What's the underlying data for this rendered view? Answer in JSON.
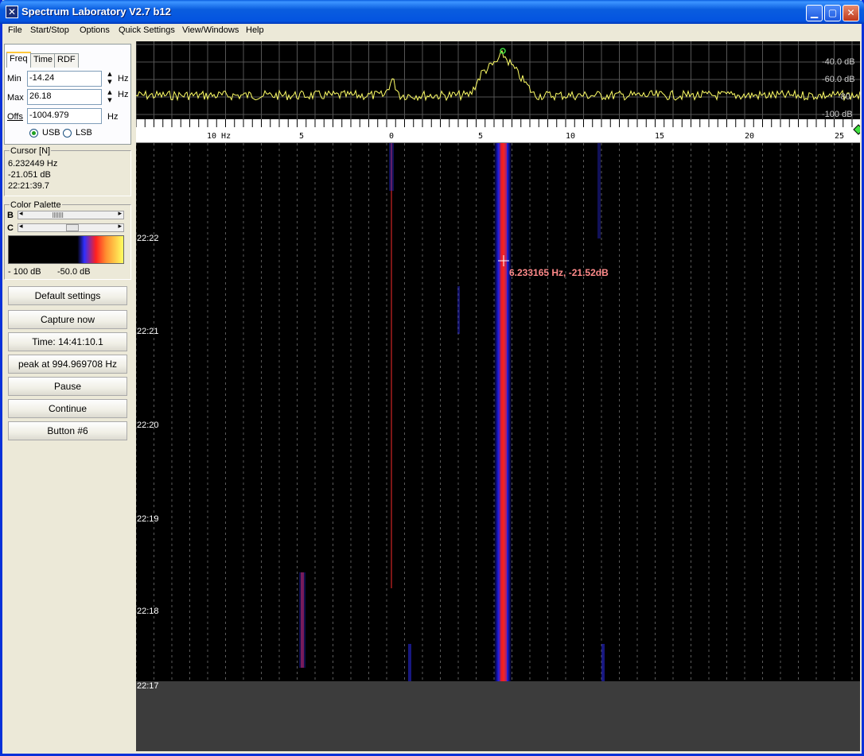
{
  "window": {
    "title": "Spectrum Laboratory V2.7 b12",
    "app_icon": "spectrum-lab-icon"
  },
  "menu": [
    "File",
    "Start/Stop",
    "Options",
    "Quick Settings",
    "View/Windows",
    "Help"
  ],
  "tabs": [
    "Freq",
    "Time",
    "RDF"
  ],
  "freq": {
    "min_label": "Min",
    "min_value": "-14.24",
    "min_unit": "Hz",
    "max_label": "Max",
    "max_value": "26.18",
    "max_unit": "Hz",
    "offs_label": "Offs",
    "offs_value": "-1004.979",
    "offs_unit": "Hz",
    "usb_label": "USB",
    "lsb_label": "LSB"
  },
  "cursor": {
    "title": "Cursor [N]",
    "freq": "6.232449 Hz",
    "level": "-21.051 dB",
    "time": "22:21:39.7"
  },
  "palette": {
    "title": "Color Palette",
    "b_label": "B",
    "c_label": "C",
    "min_label": "- 100 dB",
    "mid_label": "-50.0 dB"
  },
  "buttons": [
    "Default settings",
    "Capture now",
    "Time:  14:41:10.1",
    "peak at 994.969708 Hz",
    "Pause",
    "Continue",
    "Button #6"
  ],
  "spectrum": {
    "db_labels": [
      "-40.0 dB",
      "-60.0 dB",
      "-80",
      "-100 dB"
    ]
  },
  "freq_axis": {
    "tick_labels": [
      "10  Hz",
      "5",
      "0",
      "5",
      "10",
      "15",
      "20",
      "25"
    ]
  },
  "waterfall": {
    "time_labels": [
      "22:22",
      "22:21",
      "22:20",
      "22:19",
      "22:18",
      "22:17"
    ],
    "cursor_readout": "6.233165 Hz, -21.52dB"
  },
  "colors": {
    "titlebar": "#0a5ddf",
    "trace": "#ffff66",
    "signal_red": "#ff2020",
    "signal_blue": "#2020ff",
    "readout": "#ff8a8a"
  }
}
